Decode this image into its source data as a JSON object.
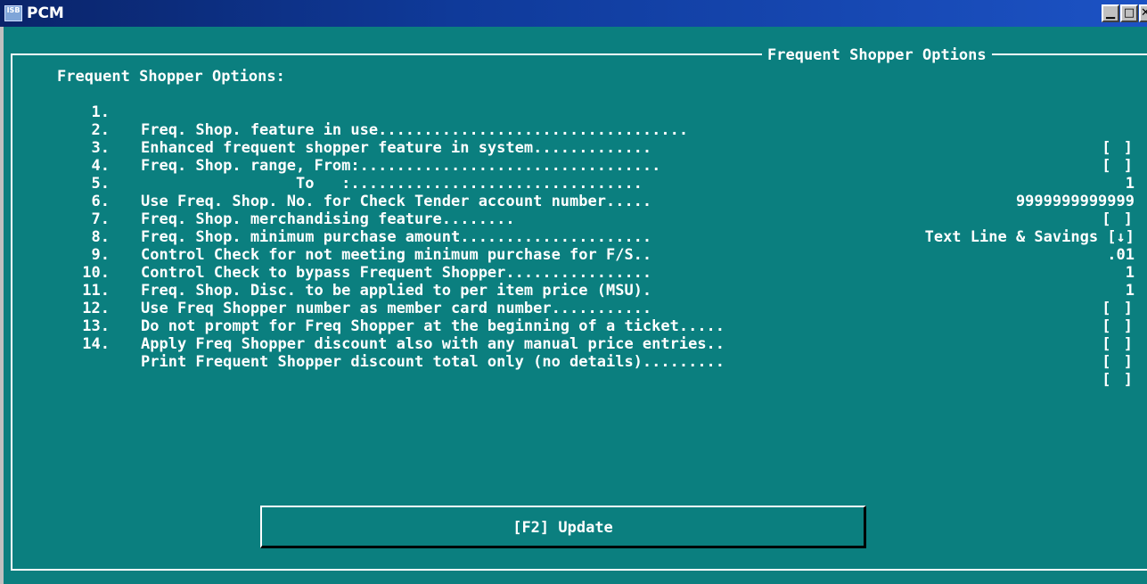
{
  "window": {
    "title": "PCM",
    "icon_label": "ISB",
    "min_glyph": "▁",
    "max_glyph": "□",
    "close_glyph": "✕"
  },
  "panel": {
    "frame_title": "Frequent Shopper Options",
    "heading": "Frequent Shopper Options:",
    "options": [
      {
        "num": "1.",
        "label": "Freq. Shop. feature in use..................................",
        "value": "[ ]"
      },
      {
        "num": "2.",
        "label": "Enhanced frequent shopper feature in system.............",
        "value": "[ ]"
      },
      {
        "num": "3.",
        "label": "Freq. Shop. range, From:.................................",
        "value": "1"
      },
      {
        "num": "4.",
        "label": "                 To   :................................",
        "value": "9999999999999"
      },
      {
        "num": "5.",
        "label": "Use Freq. Shop. No. for Check Tender account number.....",
        "value": "[ ]"
      },
      {
        "num": "6.",
        "label": "Freq. Shop. merchandising feature........",
        "value": "Text Line & Savings [↓]"
      },
      {
        "num": "7.",
        "label": "Freq. Shop. minimum purchase amount.....................",
        "value": ".01"
      },
      {
        "num": "8.",
        "label": "Control Check for not meeting minimum purchase for F/S..",
        "value": "1"
      },
      {
        "num": "9.",
        "label": "Control Check to bypass Frequent Shopper................",
        "value": "1"
      },
      {
        "num": "10.",
        "label": "Freq. Shop. Disc. to be applied to per item price (MSU).",
        "value": "[ ]"
      },
      {
        "num": "11.",
        "label": "Use Freq Shopper number as member card number...........",
        "value": "[ ]"
      },
      {
        "num": "12.",
        "label": "Do not prompt for Freq Shopper at the beginning of a ticket.....",
        "value": "[ ]"
      },
      {
        "num": "13.",
        "label": "Apply Freq Shopper discount also with any manual price entries..",
        "value": "[ ]"
      },
      {
        "num": "14.",
        "label": "Print Frequent Shopper discount total only (no details).........",
        "value": "[ ]"
      }
    ]
  },
  "update_button": {
    "label": "[F2] Update"
  },
  "colors": {
    "background": "#0b7f7f",
    "text": "#ffffff",
    "titlebar": "#0a246a"
  }
}
